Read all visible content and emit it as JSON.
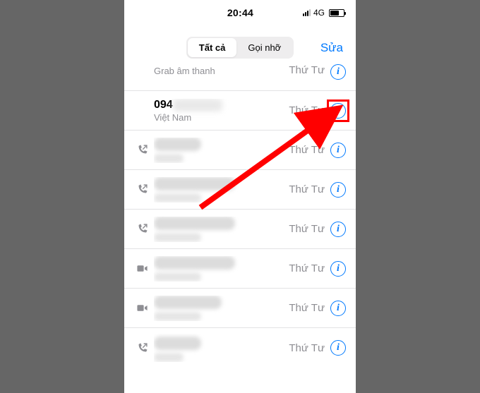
{
  "statusbar": {
    "time": "20:44",
    "network": "4G"
  },
  "header": {
    "segmented": {
      "all": "Tất cả",
      "missed": "Gọi nhỡ"
    },
    "edit": "Sửa"
  },
  "list": {
    "partial_top_subtitle": "Grab âm thanh",
    "partial_top_date": "Thứ Tư",
    "visible_row": {
      "number_prefix": "094",
      "region": "Việt Nam",
      "date": "Thứ Tư"
    },
    "generic_date": "Thứ Tư",
    "info_glyph": "i"
  },
  "annotation": {
    "highlight_color": "#ff0000",
    "target": "info-icon on row-2"
  }
}
